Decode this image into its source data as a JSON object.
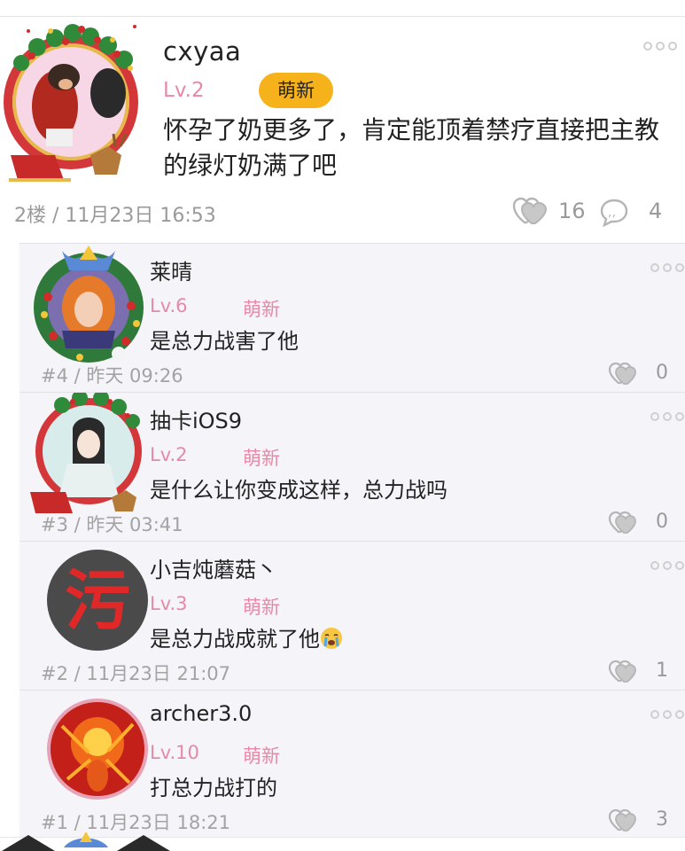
{
  "main_post": {
    "username": "cxyaa",
    "level": "Lv.2",
    "badge": "萌新",
    "body": "怀孕了奶更多了，肯定能顶着禁疗直接把主教的绿灯奶满了吧",
    "meta": "2楼 / 11月23日 16:53",
    "likes": "16",
    "comments": "4",
    "avatar_icon": "christmas-wreath-avatar"
  },
  "replies": [
    {
      "username": "莱晴",
      "level": "Lv.6",
      "badge": "萌新",
      "body": "是总力战害了他",
      "meta": "#4 / 昨天 09:26",
      "likes": "0",
      "avatar_icon": "wreath-girl-avatar"
    },
    {
      "username": "抽卡iOS9",
      "level": "Lv.2",
      "badge": "萌新",
      "body": "是什么让你变成这样，总力战吗",
      "meta": "#3 / 昨天 03:41",
      "likes": "0",
      "avatar_icon": "christmas-frame-avatar"
    },
    {
      "username": "小吉炖蘑菇丶",
      "level": "Lv.3",
      "badge": "萌新",
      "body": "是总力战成就了他",
      "emoji": "crying-face",
      "meta": "#2 / 11月23日 21:07",
      "likes": "1",
      "avatar_icon": "wu-character-avatar",
      "avatar_text": "污"
    },
    {
      "username": "archer3.0",
      "level": "Lv.10",
      "badge": "萌新",
      "body": "打总力战打的",
      "meta": "#1 / 11月23日 18:21",
      "likes": "3",
      "avatar_icon": "fire-archer-avatar"
    }
  ],
  "colors": {
    "level_pink": "#e58aa6",
    "badge_orange": "#f6b21b",
    "reply_bg": "#f5f4f8",
    "meta_gray": "#9a9a9a"
  }
}
